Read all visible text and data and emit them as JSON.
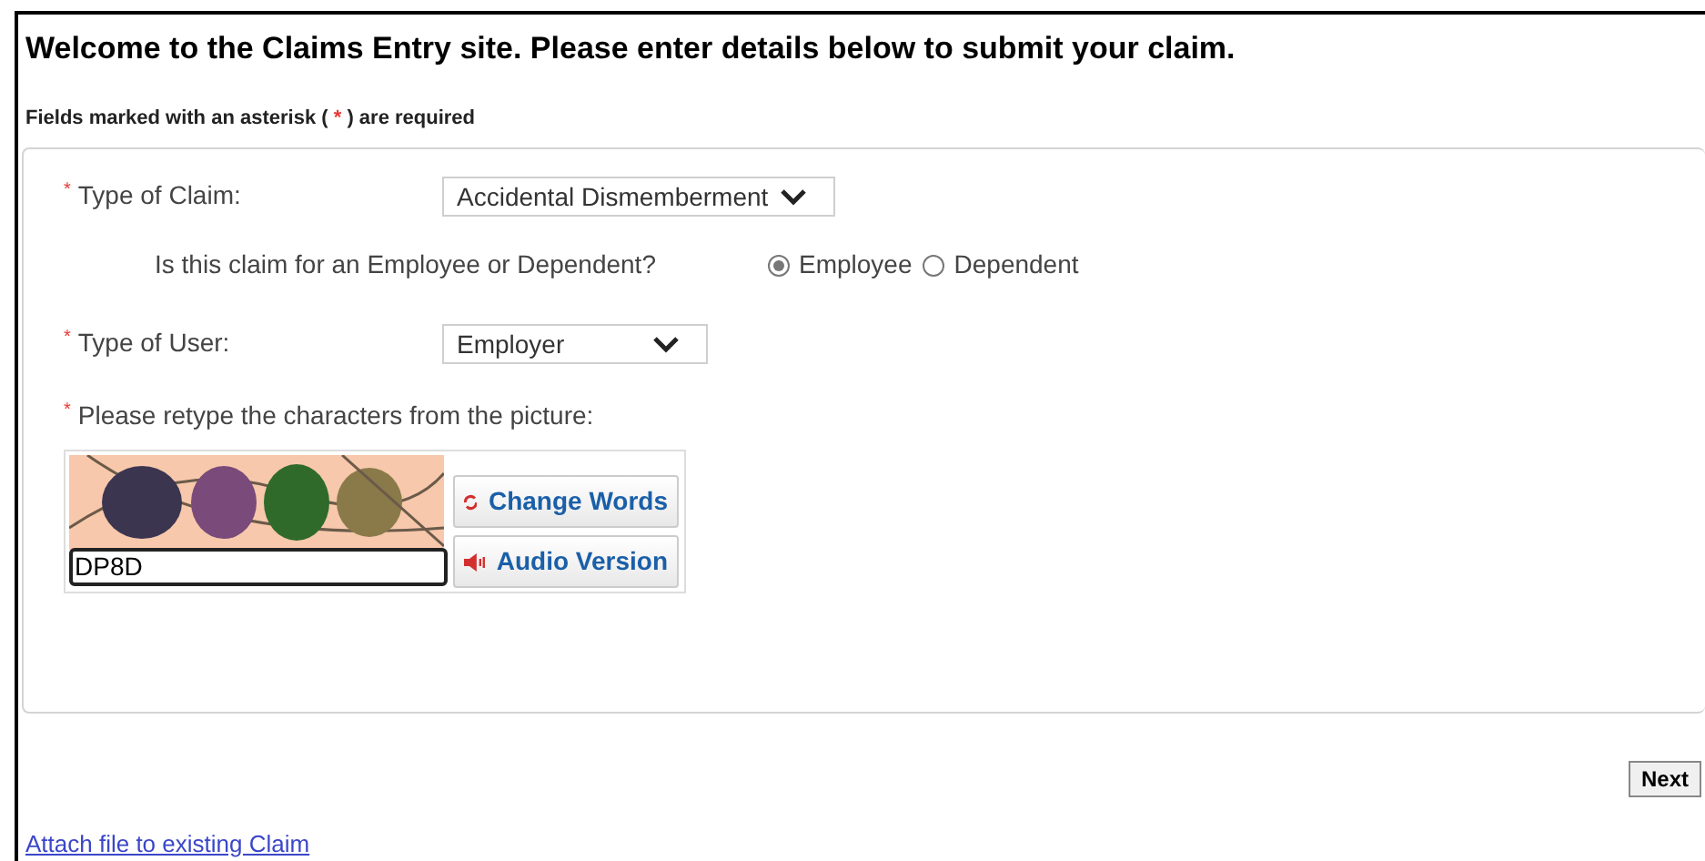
{
  "title": "Welcome to the Claims Entry site. Please enter details below to submit your claim.",
  "required_note": {
    "before": "Fields marked with an asterisk (",
    "mark": "*",
    "after": ") are required"
  },
  "claim_type": {
    "label": "Type of Claim:",
    "required": true,
    "value": "Accidental Dismemberment"
  },
  "claim_for": {
    "question": "Is this claim for an Employee or Dependent?",
    "options": [
      {
        "label": "Employee",
        "selected": true
      },
      {
        "label": "Dependent",
        "selected": false
      }
    ]
  },
  "user_type": {
    "label": "Type of User:",
    "required": true,
    "value": "Employer"
  },
  "captcha": {
    "label": "Please retype the characters from the picture:",
    "required": true,
    "change_button": "Change Words",
    "audio_button": "Audio Version",
    "value": "DP8D"
  },
  "next_button": "Next",
  "attach_link": "Attach file to existing Claim"
}
